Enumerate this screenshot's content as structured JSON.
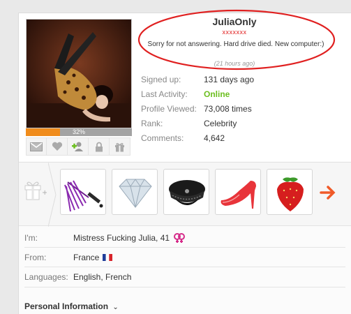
{
  "profile": {
    "username": "JuliaOnly",
    "subname": "xxxxxxx",
    "status_message": "Sorry for not answering. Hard drive died. New computer:)",
    "status_time": "(21 hours ago)",
    "progress_value": 32,
    "progress_label": "32%"
  },
  "stats": [
    {
      "label": "Signed up:",
      "value": "131 days ago"
    },
    {
      "label": "Last Activity:",
      "value": "Online"
    },
    {
      "label": "Profile Viewed:",
      "value": "73,008 times"
    },
    {
      "label": "Rank:",
      "value": "Celebrity"
    },
    {
      "label": "Comments:",
      "value": "4,642"
    }
  ],
  "actions": [
    {
      "icon": "envelope-icon"
    },
    {
      "icon": "heart-icon"
    },
    {
      "icon": "add-friend-icon"
    },
    {
      "icon": "lock-icon"
    },
    {
      "icon": "gift-icon"
    }
  ],
  "gifts": [
    {
      "icon": "whip-icon"
    },
    {
      "icon": "diamond-icon"
    },
    {
      "icon": "police-cap-icon"
    },
    {
      "icon": "high-heel-icon"
    },
    {
      "icon": "strawberry-icon"
    }
  ],
  "details": {
    "im_label": "I'm:",
    "im_value": "Mistress Fucking Julia, 41",
    "from_label": "From:",
    "from_value": "France",
    "languages_label": "Languages:",
    "languages_value": "English, French",
    "personal_info": "Personal Information"
  },
  "colors": {
    "online": "#6cbf20",
    "progress": "#f08c1c",
    "annotation": "#e02020"
  }
}
